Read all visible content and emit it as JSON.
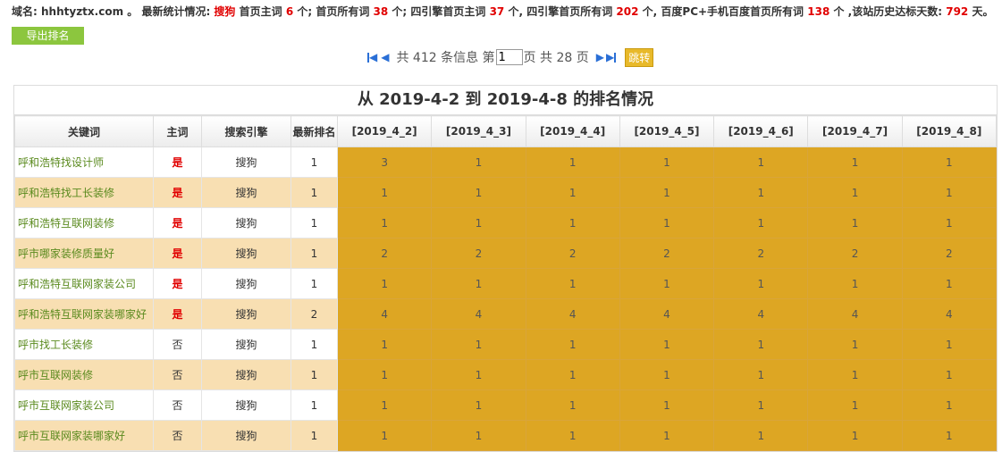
{
  "summary": {
    "domain_label": "域名:",
    "domain": "hhhtyztx.com",
    "sep1": " 。 最新统计情况: ",
    "engine": "搜狗",
    "t1": " 首页主词 ",
    "home_main": "6",
    "t2": " 个; 首页所有词 ",
    "home_all": "38",
    "t3": " 个; 四引擎首页主词",
    "four_main": "37",
    "t4": " 个, 四引擎首页所有词",
    "four_all": "202",
    "t5": " 个, 百度PC+手机百度首页所有词",
    "baidu_all": "138",
    "t6": " 个 ,该站历史达标天数: ",
    "days": "792",
    "t7": " 天。"
  },
  "export_button": "导出排名",
  "pager": {
    "total_prefix": "共 412 条信息 第",
    "page_value": "1",
    "total_pages": "页 共 28 页",
    "go": "跳转"
  },
  "table_title": "从 2019-4-2 到 2019-4-8 的排名情况",
  "headers": [
    "关键词",
    "主词",
    "搜索引擎",
    "最新排名",
    "[2019_4_2]",
    "[2019_4_3]",
    "[2019_4_4]",
    "[2019_4_5]",
    "[2019_4_6]",
    "[2019_4_7]",
    "[2019_4_8]"
  ],
  "rows": [
    {
      "kw": "呼和浩特找设计师",
      "main": "是",
      "engine": "搜狗",
      "latest": "1",
      "ranks": [
        "3",
        "1",
        "1",
        "1",
        "1",
        "1",
        "1"
      ]
    },
    {
      "kw": "呼和浩特找工长装修",
      "main": "是",
      "engine": "搜狗",
      "latest": "1",
      "ranks": [
        "1",
        "1",
        "1",
        "1",
        "1",
        "1",
        "1"
      ]
    },
    {
      "kw": "呼和浩特互联网装修",
      "main": "是",
      "engine": "搜狗",
      "latest": "1",
      "ranks": [
        "1",
        "1",
        "1",
        "1",
        "1",
        "1",
        "1"
      ]
    },
    {
      "kw": "呼市哪家装修质量好",
      "main": "是",
      "engine": "搜狗",
      "latest": "1",
      "ranks": [
        "2",
        "2",
        "2",
        "2",
        "2",
        "2",
        "2"
      ]
    },
    {
      "kw": "呼和浩特互联网家装公司",
      "main": "是",
      "engine": "搜狗",
      "latest": "1",
      "ranks": [
        "1",
        "1",
        "1",
        "1",
        "1",
        "1",
        "1"
      ]
    },
    {
      "kw": "呼和浩特互联网家装哪家好",
      "main": "是",
      "engine": "搜狗",
      "latest": "2",
      "ranks": [
        "4",
        "4",
        "4",
        "4",
        "4",
        "4",
        "4"
      ]
    },
    {
      "kw": "呼市找工长装修",
      "main": "否",
      "engine": "搜狗",
      "latest": "1",
      "ranks": [
        "1",
        "1",
        "1",
        "1",
        "1",
        "1",
        "1"
      ]
    },
    {
      "kw": "呼市互联网装修",
      "main": "否",
      "engine": "搜狗",
      "latest": "1",
      "ranks": [
        "1",
        "1",
        "1",
        "1",
        "1",
        "1",
        "1"
      ]
    },
    {
      "kw": "呼市互联网家装公司",
      "main": "否",
      "engine": "搜狗",
      "latest": "1",
      "ranks": [
        "1",
        "1",
        "1",
        "1",
        "1",
        "1",
        "1"
      ]
    },
    {
      "kw": "呼市互联网家装哪家好",
      "main": "否",
      "engine": "搜狗",
      "latest": "1",
      "ranks": [
        "1",
        "1",
        "1",
        "1",
        "1",
        "1",
        "1"
      ]
    }
  ]
}
